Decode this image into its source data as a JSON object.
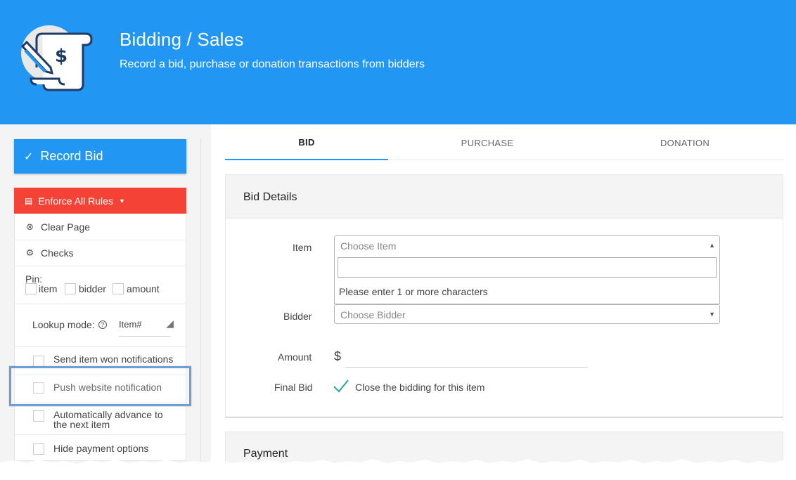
{
  "header": {
    "title": "Bidding / Sales",
    "subtitle": "Record a bid, purchase or donation transactions from bidders",
    "logo_icon": "bid-receipt-icon",
    "color": "#2196f3"
  },
  "sidebar": {
    "record_button": "Record Bid",
    "enforce_button": "Enforce All Rules",
    "clear_page": "Clear Page",
    "checks": "Checks",
    "pin_label": "Pin:",
    "pin_options": [
      "item",
      "bidder",
      "amount"
    ],
    "lookup_label": "Lookup mode:",
    "lookup_value": "Item#",
    "options": [
      "Send item won notifications",
      "Push website notification",
      "Automatically advance to",
      "the next item",
      "Hide payment options"
    ],
    "danger_color": "#f44336"
  },
  "tabs": [
    "BID",
    "PURCHASE",
    "DONATION"
  ],
  "bid_details": {
    "title": "Bid Details",
    "item_label": "Item",
    "item_placeholder": "Choose Item",
    "dropdown_message": "Please enter 1 or more characters",
    "bidder_label": "Bidder",
    "bidder_placeholder": "Choose Bidder",
    "amount_label": "Amount",
    "currency": "$",
    "final_bid_label": "Final Bid",
    "final_bid_text": "Close the bidding for this item",
    "final_bid_checked": true
  },
  "payment": {
    "title": "Payment"
  }
}
